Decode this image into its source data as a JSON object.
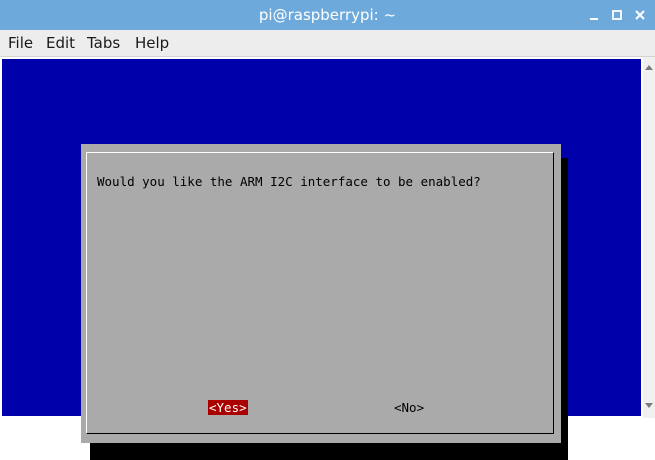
{
  "window": {
    "title": "pi@raspberrypi: ~"
  },
  "menu": {
    "items": [
      "File",
      "Edit",
      "Tabs",
      "Help"
    ]
  },
  "dialog": {
    "message": "Would you like the ARM I2C interface to be enabled?",
    "yes_label": "<Yes>",
    "no_label": "<No>",
    "selected": "yes"
  },
  "colors": {
    "titlebar": "#6ea9dc",
    "terminal_background": "#0000aa",
    "dialog_background": "#aaaaaa",
    "selected_button": "#aa0000"
  },
  "icons": [
    "minimize-icon",
    "maximize-icon",
    "close-icon"
  ]
}
